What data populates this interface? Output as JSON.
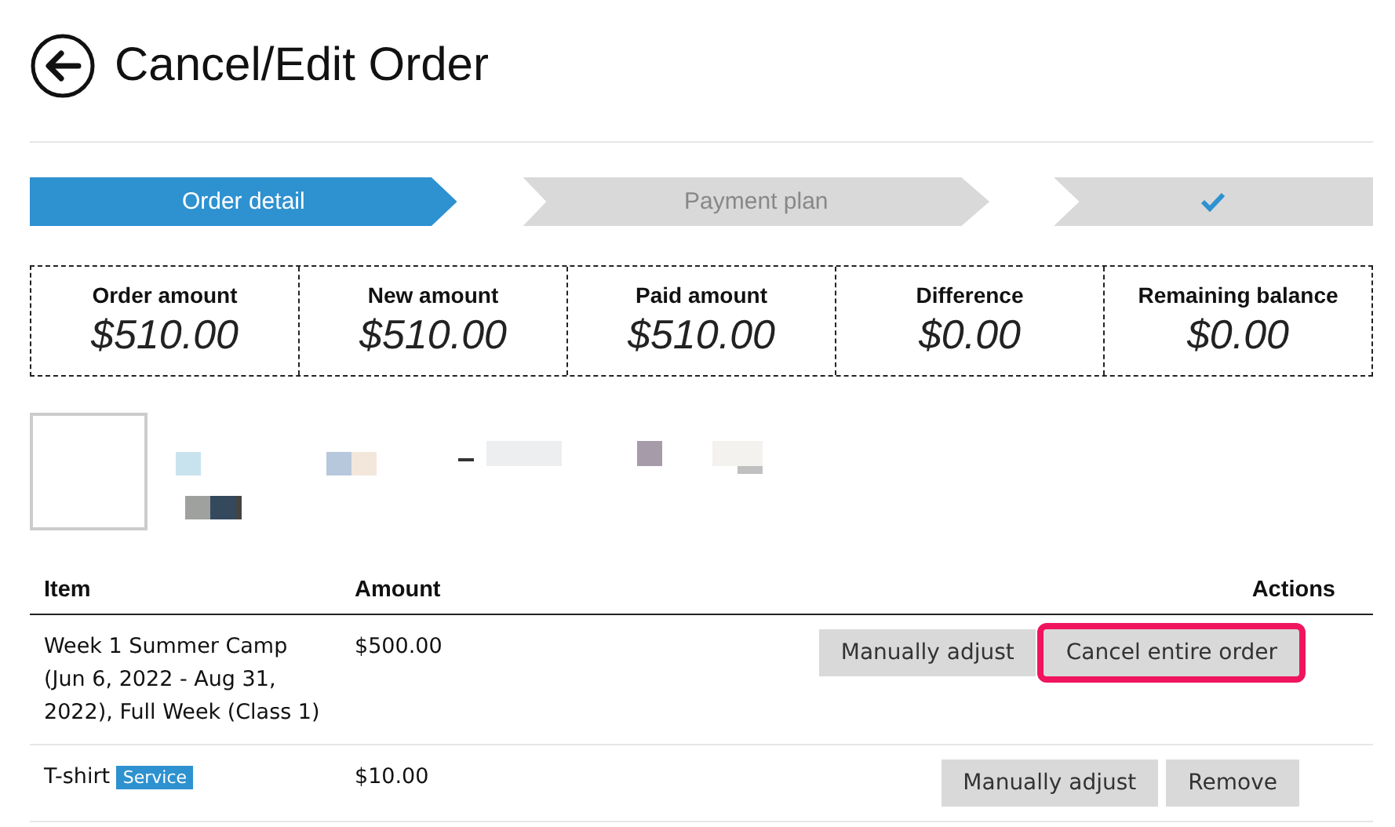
{
  "page": {
    "title": "Cancel/Edit Order"
  },
  "steps": [
    {
      "kind": "text",
      "label": "Order detail",
      "selected": true
    },
    {
      "kind": "text",
      "label": "Payment plan",
      "selected": false
    },
    {
      "kind": "check",
      "selected": false
    }
  ],
  "summary": [
    {
      "label": "Order amount",
      "value": "$510.00"
    },
    {
      "label": "New amount",
      "value": "$510.00"
    },
    {
      "label": "Paid amount",
      "value": "$510.00"
    },
    {
      "label": "Difference",
      "value": "$0.00"
    },
    {
      "label": "Remaining balance",
      "value": "$0.00"
    }
  ],
  "table": {
    "columns": [
      "Item",
      "Amount",
      "Actions"
    ],
    "rows": [
      {
        "item": "Week 1 Summer Camp (Jun 6, 2022 - Aug 31, 2022), Full Week (Class 1)",
        "amount": "$500.00",
        "actions": [
          {
            "label": "Manually adjust",
            "highlighted": false
          },
          {
            "label": "Cancel entire order",
            "highlighted": true
          }
        ]
      },
      {
        "item": "T-shirt",
        "tag": "Service",
        "amount": "$10.00",
        "actions": [
          {
            "label": "Manually adjust",
            "highlighted": false
          },
          {
            "label": "Remove",
            "highlighted": false
          }
        ]
      }
    ]
  }
}
